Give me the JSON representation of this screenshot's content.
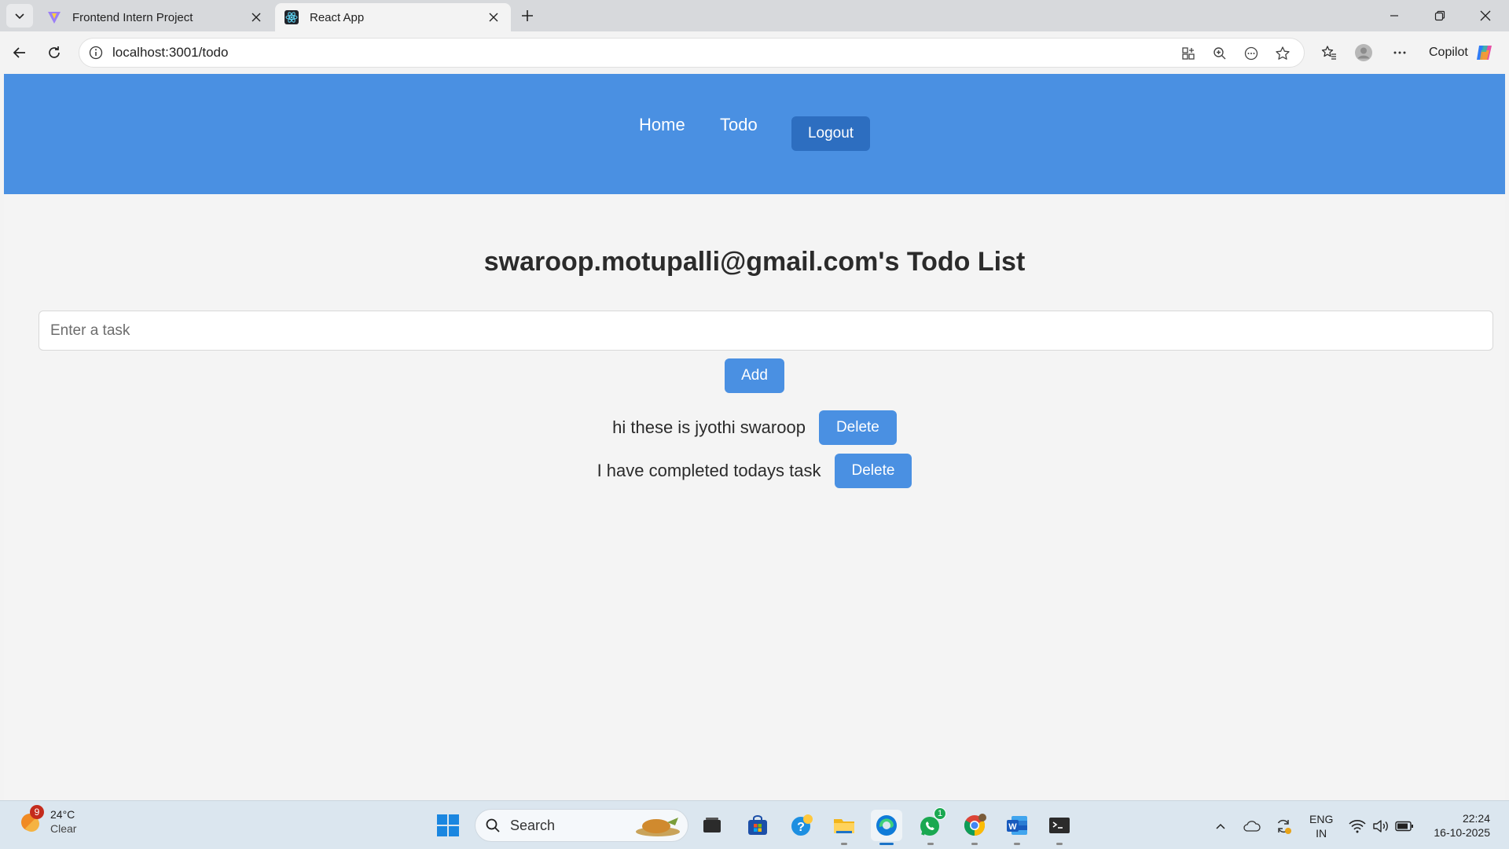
{
  "browser": {
    "tabs": [
      {
        "title": "Frontend Intern Project",
        "favicon": "vite-icon",
        "active": false
      },
      {
        "title": "React App",
        "favicon": "react-icon",
        "active": true
      }
    ],
    "url": "localhost:3001/todo",
    "copilot_label": "Copilot"
  },
  "app": {
    "nav": {
      "home": "Home",
      "todo": "Todo",
      "logout": "Logout"
    },
    "heading": "swaroop.motupalli@gmail.com's Todo List",
    "input_placeholder": "Enter a task",
    "add_label": "Add",
    "todos": [
      {
        "text": "hi these is jyothi swaroop",
        "delete_label": "Delete"
      },
      {
        "text": "I have completed todays task",
        "delete_label": "Delete"
      }
    ],
    "colors": {
      "nav_bg": "#4a90e2",
      "button_bg": "#4a90e2",
      "logout_bg": "#2d6ec0"
    }
  },
  "taskbar": {
    "weather": {
      "temp": "24°C",
      "condition": "Clear",
      "badge": "9"
    },
    "search_label": "Search",
    "whatsapp_badge": "1",
    "lang": {
      "line1": "ENG",
      "line2": "IN"
    },
    "clock": {
      "time": "22:24",
      "date": "16-10-2025"
    }
  }
}
